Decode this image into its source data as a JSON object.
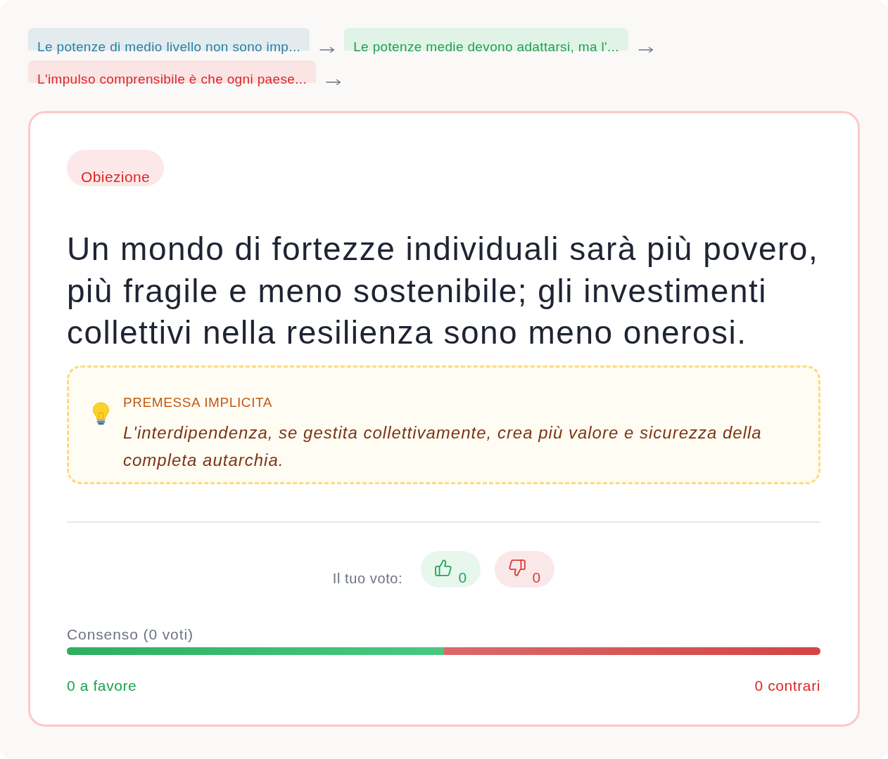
{
  "breadcrumb": [
    {
      "kind": "premise",
      "text": "Le potenze di medio livello non sono imp..."
    },
    {
      "kind": "support",
      "text": "Le potenze medie devono adattarsi, ma l'..."
    },
    {
      "kind": "objection",
      "text": "L'impulso comprensibile è che ogni paese..."
    }
  ],
  "card": {
    "kind": "objection",
    "badge": "Obiezione",
    "claim": "Un mondo di fortezze individuali sarà più povero, più fragile e meno sostenibile; gli investimenti collettivi nella resilienza sono meno onerosi.",
    "premise": {
      "label": "PREMESSA IMPLICITA",
      "text": "L'interdipendenza, se gestita collettivamente, crea più valore e sicurezza della completa autarchia."
    }
  },
  "vote": {
    "label": "Il tuo voto:",
    "up": {
      "count": "0"
    },
    "down": {
      "count": "0"
    }
  },
  "consensus": {
    "label": "Consenso (0 voti)",
    "level": 0.5,
    "for": "0 a favore",
    "against": "0 contrari"
  }
}
